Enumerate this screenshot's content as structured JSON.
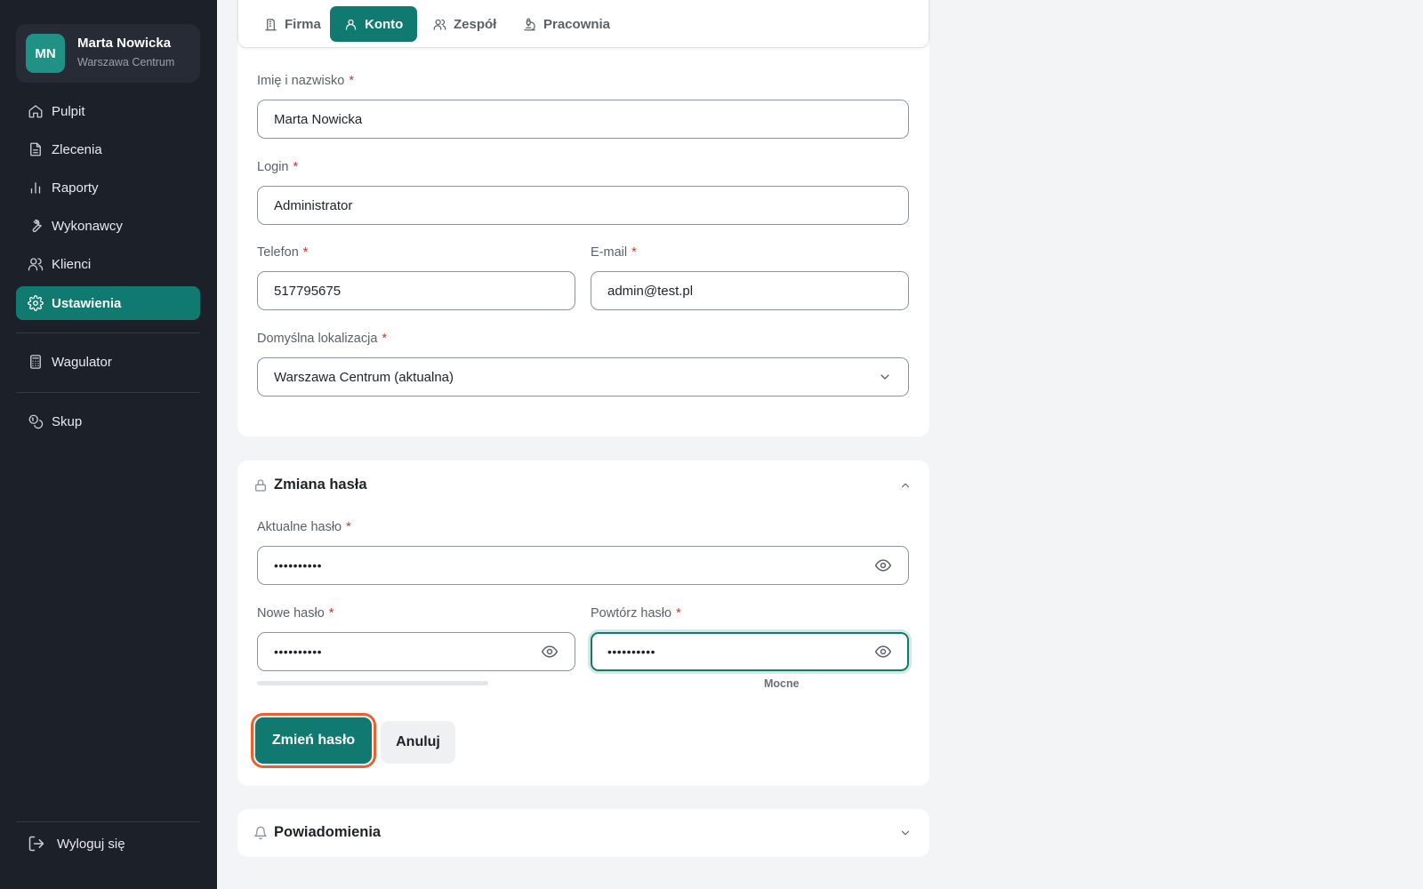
{
  "user": {
    "initials": "MN",
    "name": "Marta Nowicka",
    "location": "Warszawa Centrum"
  },
  "sidebar": {
    "items": [
      {
        "label": "Pulpit",
        "icon": "home-icon"
      },
      {
        "label": "Zlecenia",
        "icon": "document-icon"
      },
      {
        "label": "Raporty",
        "icon": "bar-chart-icon"
      },
      {
        "label": "Wykonawcy",
        "icon": "wrench-icon"
      },
      {
        "label": "Klienci",
        "icon": "users-icon"
      },
      {
        "label": "Ustawienia",
        "icon": "gear-icon",
        "active": true
      },
      {
        "label": "Wagulator",
        "icon": "calculator-icon"
      },
      {
        "label": "Skup",
        "icon": "coins-icon"
      }
    ],
    "logout_label": "Wyloguj się"
  },
  "tabs": [
    {
      "label": "Firma",
      "icon": "building-icon"
    },
    {
      "label": "Konto",
      "icon": "user-icon",
      "active": true
    },
    {
      "label": "Zespół",
      "icon": "users-icon"
    },
    {
      "label": "Pracownia",
      "icon": "microscope-icon"
    }
  ],
  "account_form": {
    "name": {
      "label": "Imię i nazwisko",
      "required_mark": "*",
      "value": "Marta Nowicka"
    },
    "login": {
      "label": "Login",
      "required_mark": "*",
      "value": "Administrator"
    },
    "phone": {
      "label": "Telefon",
      "required_mark": "*",
      "value": "517795675"
    },
    "email": {
      "label": "E-mail",
      "required_mark": "*",
      "value": "admin@test.pl"
    },
    "location": {
      "label": "Domyślna lokalizacja",
      "required_mark": "*",
      "value": "Warszawa Centrum (aktualna)"
    }
  },
  "password_section": {
    "title": "Zmiana hasła",
    "expanded": true,
    "current": {
      "label": "Aktualne hasło",
      "required_mark": "*",
      "value": "••••••••••"
    },
    "new": {
      "label": "Nowe hasło",
      "required_mark": "*",
      "value": "••••••••••"
    },
    "repeat": {
      "label": "Powtórz hasło",
      "required_mark": "*",
      "value": "••••••••••"
    },
    "strength_label": "Mocne",
    "submit_label": "Zmień hasło",
    "cancel_label": "Anuluj"
  },
  "notifications_section": {
    "title": "Powiadomienia",
    "expanded": false
  },
  "colors": {
    "accent": "#117a70",
    "sidebar_bg": "#1c2029",
    "required": "#c0392b",
    "focus_ring": "#e8622f"
  }
}
